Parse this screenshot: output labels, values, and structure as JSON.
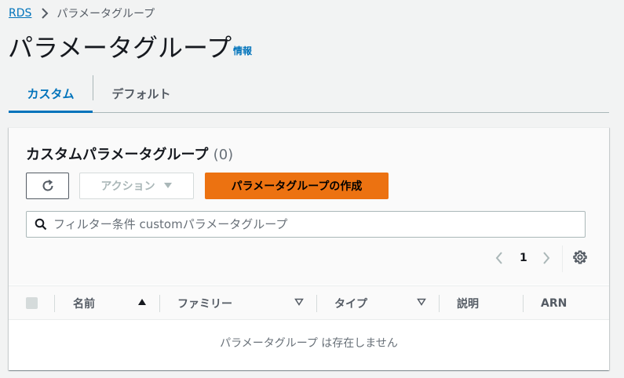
{
  "breadcrumb": {
    "root": "RDS",
    "current": "パラメータグループ"
  },
  "page": {
    "title": "パラメータグループ",
    "info_link": "情報"
  },
  "tabs": [
    {
      "label": "カスタム",
      "active": true
    },
    {
      "label": "デフォルト",
      "active": false
    }
  ],
  "panel": {
    "title": "カスタムパラメータグループ",
    "count": "(0)",
    "actions_label": "アクション",
    "create_label": "パラメータグループの作成",
    "filter_placeholder": "フィルター条件 customパラメータグループ",
    "page_number": "1"
  },
  "table": {
    "columns": [
      {
        "label": "名前",
        "sort": "ascending"
      },
      {
        "label": "ファミリー",
        "sort": "sortable"
      },
      {
        "label": "タイプ",
        "sort": "sortable"
      },
      {
        "label": "説明",
        "sort": "none"
      },
      {
        "label": "ARN",
        "sort": "none"
      }
    ],
    "empty_message": "パラメータグループ は存在しません"
  },
  "colors": {
    "link": "#0073bb",
    "primary_button": "#ec7211",
    "text": "#16191f",
    "muted": "#545b64",
    "disabled": "#aab7b8"
  },
  "icons": [
    "chevron-right-icon",
    "refresh-icon",
    "caret-down-icon",
    "search-icon",
    "chevron-left-icon",
    "settings-gear-icon",
    "sort-ascending-icon",
    "sort-icon"
  ]
}
